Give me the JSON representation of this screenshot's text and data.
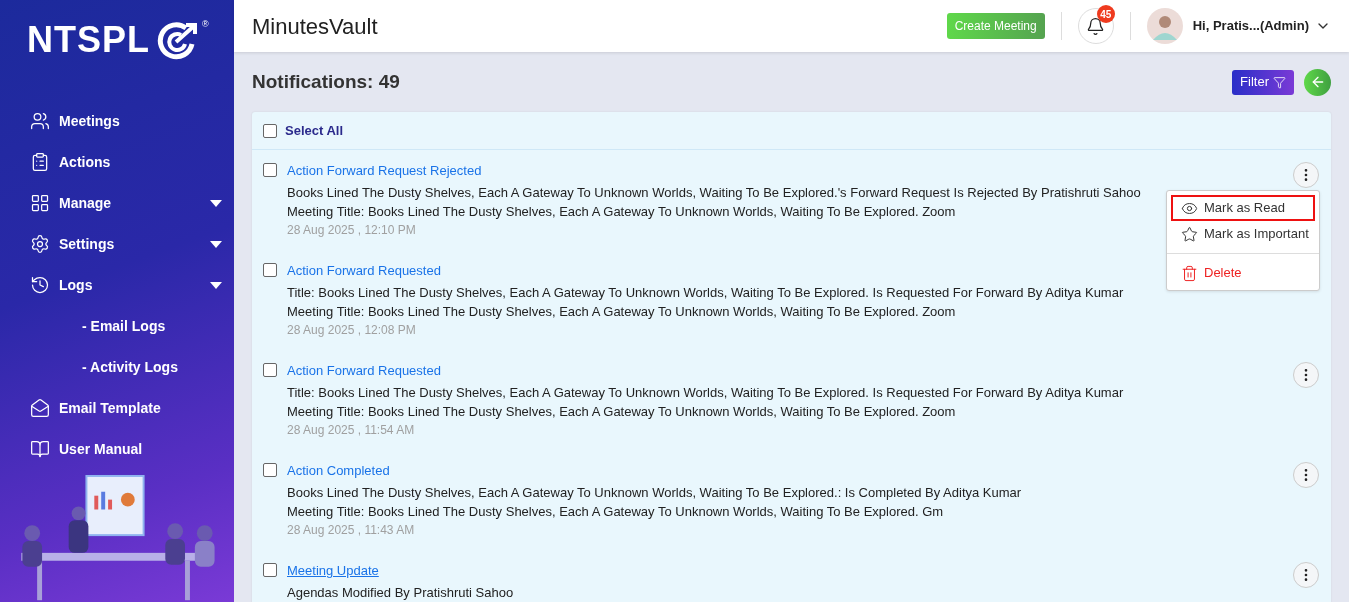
{
  "brand": {
    "logo_text": "NTSPL",
    "registered": "®"
  },
  "sidebar": {
    "items": [
      {
        "label": "Meetings",
        "kind": "main",
        "expandable": false
      },
      {
        "label": "Actions",
        "kind": "main",
        "expandable": false
      },
      {
        "label": "Manage",
        "kind": "main",
        "expandable": true
      },
      {
        "label": "Settings",
        "kind": "main",
        "expandable": true
      },
      {
        "label": "Logs",
        "kind": "main",
        "expandable": true
      },
      {
        "label": "- Email Logs",
        "kind": "sub",
        "expandable": false
      },
      {
        "label": "- Activity Logs",
        "kind": "sub",
        "expandable": false
      },
      {
        "label": "Email Template",
        "kind": "main",
        "expandable": false
      },
      {
        "label": "User Manual",
        "kind": "main",
        "expandable": false
      }
    ]
  },
  "header": {
    "title": "MinutesVault",
    "create_button": "Create Meeting",
    "notification_count": "45",
    "user": "Hi, Pratis...(Admin)"
  },
  "page": {
    "title": "Notifications: 49",
    "filter_button": "Filter"
  },
  "select_all": {
    "label": "Select All",
    "checked": false
  },
  "notifications": [
    {
      "title": "Action Forward Request Rejected",
      "underlined": false,
      "checked": false,
      "lines": [
        "Books Lined The Dusty Shelves, Each A Gateway To Unknown Worlds, Waiting To Be Explored.'s Forward Request Is Rejected By Pratishruti Sahoo",
        "Meeting Title: Books Lined The Dusty Shelves, Each A Gateway To Unknown Worlds, Waiting To Be Explored. Zoom"
      ],
      "time": "28 Aug 2025 , 12:10 PM"
    },
    {
      "title": "Action Forward Requested",
      "underlined": false,
      "checked": false,
      "lines": [
        "Title: Books Lined The Dusty Shelves, Each A Gateway To Unknown Worlds, Waiting To Be Explored. Is Requested For Forward By Aditya Kumar",
        "Meeting Title: Books Lined The Dusty Shelves, Each A Gateway To Unknown Worlds, Waiting To Be Explored. Zoom"
      ],
      "time": "28 Aug 2025 , 12:08 PM"
    },
    {
      "title": "Action Forward Requested",
      "underlined": false,
      "checked": false,
      "lines": [
        "Title: Books Lined The Dusty Shelves, Each A Gateway To Unknown Worlds, Waiting To Be Explored. Is Requested For Forward By Aditya Kumar",
        "Meeting Title: Books Lined The Dusty Shelves, Each A Gateway To Unknown Worlds, Waiting To Be Explored. Zoom"
      ],
      "time": "28 Aug 2025 , 11:54 AM"
    },
    {
      "title": "Action Completed",
      "underlined": false,
      "checked": false,
      "lines": [
        "Books Lined The Dusty Shelves, Each A Gateway To Unknown Worlds, Waiting To Be Explored.: Is Completed By Aditya Kumar",
        "Meeting Title: Books Lined The Dusty Shelves, Each A Gateway To Unknown Worlds, Waiting To Be Explored. Gm"
      ],
      "time": "28 Aug 2025 , 11:43 AM"
    },
    {
      "title": "Meeting Update",
      "underlined": true,
      "checked": false,
      "lines": [
        "Agendas Modified By Pratishruti Sahoo"
      ]
    }
  ],
  "context_menu": {
    "items": [
      {
        "label": "Mark as Read",
        "kind": "normal",
        "highlighted": true
      },
      {
        "label": "Mark as Important",
        "kind": "normal",
        "highlighted": false
      },
      {
        "label": "Delete",
        "kind": "danger",
        "highlighted": false
      }
    ]
  }
}
